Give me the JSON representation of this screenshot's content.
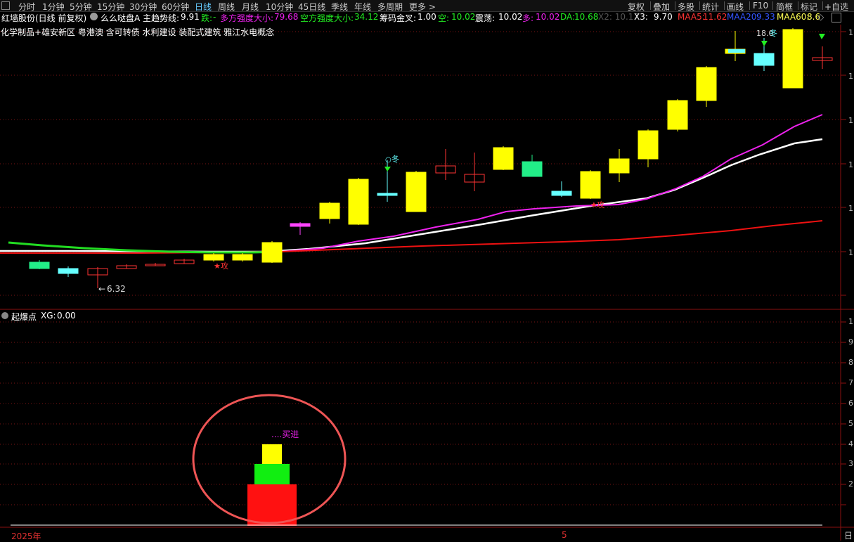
{
  "toolbar": {
    "periods": [
      "分时",
      "1分钟",
      "5分钟",
      "15分钟",
      "30分钟",
      "60分钟",
      "日线",
      "周线",
      "月线",
      "10分钟",
      "45日线",
      "季线",
      "年线",
      "多周期",
      "更多 >"
    ],
    "active_period": "日线",
    "right_buttons": [
      "复权",
      "叠加",
      "多股",
      "统计",
      "画线",
      "F10",
      "简框",
      "标记",
      "+自选"
    ]
  },
  "info": {
    "stock": "红墙股份(日线 前复权)",
    "indicator": "么么哒盘A",
    "main_trend_label": "主趋势线:",
    "main_trend_value": "9.91",
    "fall_label": "跌:",
    "fall_value": "-",
    "bull_label": "多方强度大小:",
    "bull_value": "79.68",
    "bear_label": "空方强度大小:",
    "bear_value": "34.12",
    "chip_label": "筹码金叉:",
    "chip_value": "1.00",
    "empty_label": "空:",
    "empty_value": "10.02",
    "shock_label": "震荡:",
    "shock_value": "10.02",
    "multi_label": "多:",
    "multi_value": "10.02",
    "da_label": "DA:",
    "da_value": "10.68",
    "x2_text": "X2: 10.17",
    "x3_label": "X3:",
    "x3_value": "9.70",
    "maa5_label": "MAA5:",
    "maa5_value": "11.62",
    "maa20_label": "MAA20:",
    "maa20_value": "9.33",
    "maa60_label": "MAA60:",
    "maa60_value": "8.6"
  },
  "concepts": "化学制品+雄安新区 粤港澳 含可转债 水利建设 装配式建筑 雅江水电概念",
  "annotations": {
    "low_price": "6.32",
    "attack": "攻",
    "winter_top": "冬",
    "peak_label": "18.0",
    "peak_mark": "冬",
    "mid_mark": "攻"
  },
  "sub_panel": {
    "title": "起爆点",
    "xg_label": "XG:",
    "xg_value": "0.00",
    "buy_label": "....买进"
  },
  "xaxis": {
    "left": "2025年",
    "mid": "5",
    "right": "日"
  },
  "colors": {
    "up_candle": "#ffff00",
    "down_cyan": "#66ffff",
    "down_green": "#22ee88",
    "hollow_red": "#ff3333",
    "ma_white": "#ffffff",
    "ma_magenta": "#ee22ee",
    "ma_red": "#ee1111",
    "ma_green": "#22dd22"
  }
}
